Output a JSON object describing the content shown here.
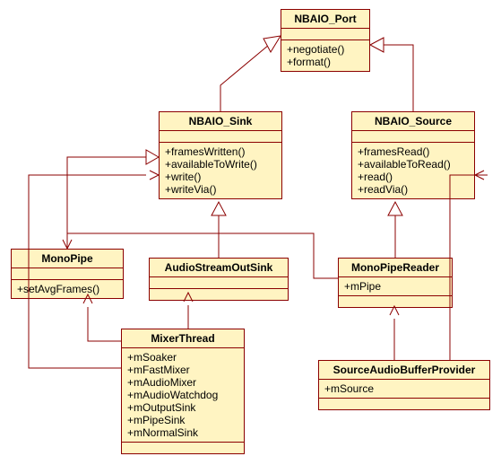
{
  "classes": {
    "nbaio_port": {
      "name": "NBAIO_Port",
      "methods": [
        "+negotiate()",
        "+format()"
      ]
    },
    "nbaio_sink": {
      "name": "NBAIO_Sink",
      "methods": [
        "+framesWritten()",
        "+availableToWrite()",
        "+write()",
        "+writeVia()"
      ]
    },
    "nbaio_source": {
      "name": "NBAIO_Source",
      "methods": [
        "+framesRead()",
        "+availableToRead()",
        "+read()",
        "+readVia()"
      ]
    },
    "mono_pipe": {
      "name": "MonoPipe",
      "methods": [
        "+setAvgFrames()"
      ]
    },
    "audio_stream_out_sink": {
      "name": "AudioStreamOutSink"
    },
    "mono_pipe_reader": {
      "name": "MonoPipeReader",
      "members": [
        "+mPipe"
      ]
    },
    "mixer_thread": {
      "name": "MixerThread",
      "members": [
        "+mSoaker",
        "+mFastMixer",
        "+mAudioMixer",
        "+mAudioWatchdog",
        "+mOutputSink",
        "+mPipeSink",
        "+mNormalSink"
      ]
    },
    "source_audio_buffer_provider": {
      "name": "SourceAudioBufferProvider",
      "members": [
        "+mSource"
      ]
    }
  },
  "chart_data": {
    "type": "table",
    "diagram_type": "uml_class_diagram",
    "classes": [
      {
        "name": "NBAIO_Port",
        "operations": [
          "negotiate()",
          "format()"
        ]
      },
      {
        "name": "NBAIO_Sink",
        "operations": [
          "framesWritten()",
          "availableToWrite()",
          "write()",
          "writeVia()"
        ]
      },
      {
        "name": "NBAIO_Source",
        "operations": [
          "framesRead()",
          "availableToRead()",
          "read()",
          "readVia()"
        ]
      },
      {
        "name": "MonoPipe",
        "operations": [
          "setAvgFrames()"
        ]
      },
      {
        "name": "AudioStreamOutSink"
      },
      {
        "name": "MonoPipeReader",
        "attributes": [
          "mPipe"
        ]
      },
      {
        "name": "MixerThread",
        "attributes": [
          "mSoaker",
          "mFastMixer",
          "mAudioMixer",
          "mAudioWatchdog",
          "mOutputSink",
          "mPipeSink",
          "mNormalSink"
        ]
      },
      {
        "name": "SourceAudioBufferProvider",
        "attributes": [
          "mSource"
        ]
      }
    ],
    "relationships": [
      {
        "from": "NBAIO_Sink",
        "to": "NBAIO_Port",
        "type": "generalization"
      },
      {
        "from": "NBAIO_Source",
        "to": "NBAIO_Port",
        "type": "generalization"
      },
      {
        "from": "MonoPipe",
        "to": "NBAIO_Sink",
        "type": "generalization"
      },
      {
        "from": "AudioStreamOutSink",
        "to": "NBAIO_Sink",
        "type": "generalization"
      },
      {
        "from": "MonoPipeReader",
        "to": "NBAIO_Source",
        "type": "generalization"
      },
      {
        "from": "MixerThread",
        "to": "NBAIO_Sink",
        "type": "association"
      },
      {
        "from": "MixerThread",
        "to": "MonoPipe",
        "type": "association"
      },
      {
        "from": "MixerThread",
        "to": "AudioStreamOutSink",
        "type": "association"
      },
      {
        "from": "MonoPipeReader",
        "to": "MonoPipe",
        "type": "association"
      },
      {
        "from": "SourceAudioBufferProvider",
        "to": "NBAIO_Source",
        "type": "association"
      },
      {
        "from": "SourceAudioBufferProvider",
        "to": "MonoPipeReader",
        "type": "association"
      }
    ]
  }
}
